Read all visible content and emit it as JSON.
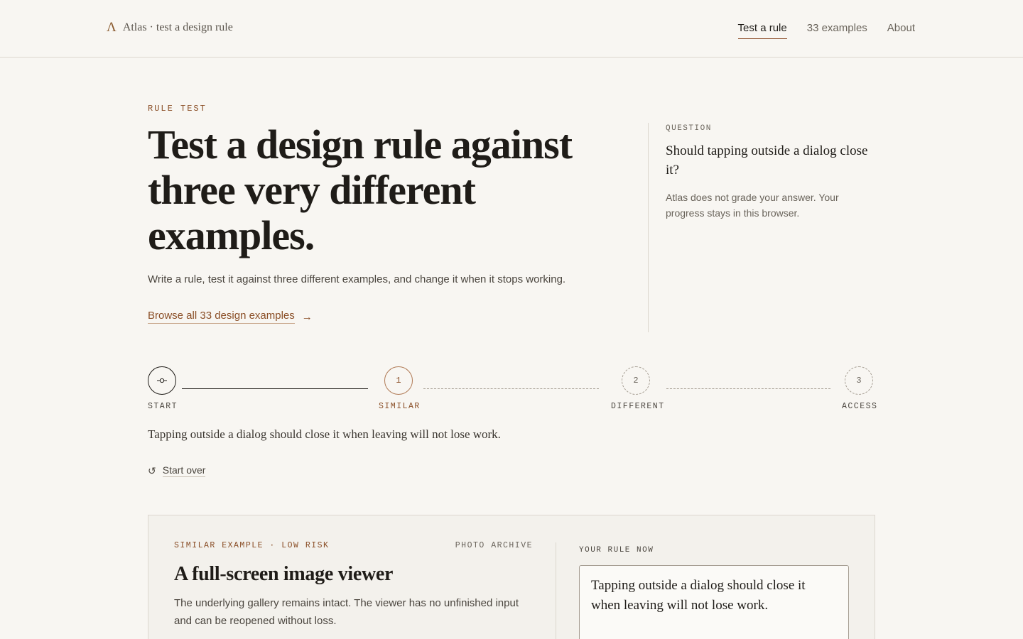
{
  "header": {
    "brand_mark": "Λ",
    "brand_text": "Atlas · test a design rule",
    "nav": [
      {
        "label": "Test a rule",
        "active": true
      },
      {
        "label": "33 examples",
        "active": false
      },
      {
        "label": "About",
        "active": false
      }
    ]
  },
  "hero": {
    "eyebrow": "RULE TEST",
    "title": "Test a design rule against three very different examples.",
    "subtitle": "Write a rule, test it against three different examples, and change it when it stops working.",
    "browse_link": "Browse all 33 design examples",
    "browse_icon": "arrow-right-icon"
  },
  "sidebar": {
    "eyebrow": "QUESTION",
    "question": "Should tapping outside a dialog close it?",
    "note": "Atlas does not grade your answer. Your progress stays in this browser."
  },
  "stepper": {
    "steps": [
      {
        "marker": "",
        "icon": "commit-icon",
        "label": "START",
        "state": "done"
      },
      {
        "marker": "1",
        "label": "SIMILAR",
        "state": "active"
      },
      {
        "marker": "2",
        "label": "DIFFERENT",
        "state": "todo"
      },
      {
        "marker": "3",
        "label": "ACCESS",
        "state": "todo"
      }
    ]
  },
  "current_rule": "Tapping outside a dialog should close it when leaving will not lose work.",
  "start_over": {
    "label": "Start over",
    "icon": "restart-icon"
  },
  "example_card": {
    "tag": "SIMILAR EXAMPLE · LOW RISK",
    "category": "PHOTO ARCHIVE",
    "title": "A full-screen image viewer",
    "description": "The underlying gallery remains intact. The viewer has no unfinished input and can be reopened without loss.",
    "rule_label": "YOUR RULE NOW",
    "rule_text": "Tapping outside a dialog should close it when leaving will not lose work."
  },
  "colors": {
    "background": "#f8f6f2",
    "accent": "#8a4e26",
    "text": "#1f1c18",
    "muted": "#6a645b",
    "border": "#dcd7cf"
  }
}
